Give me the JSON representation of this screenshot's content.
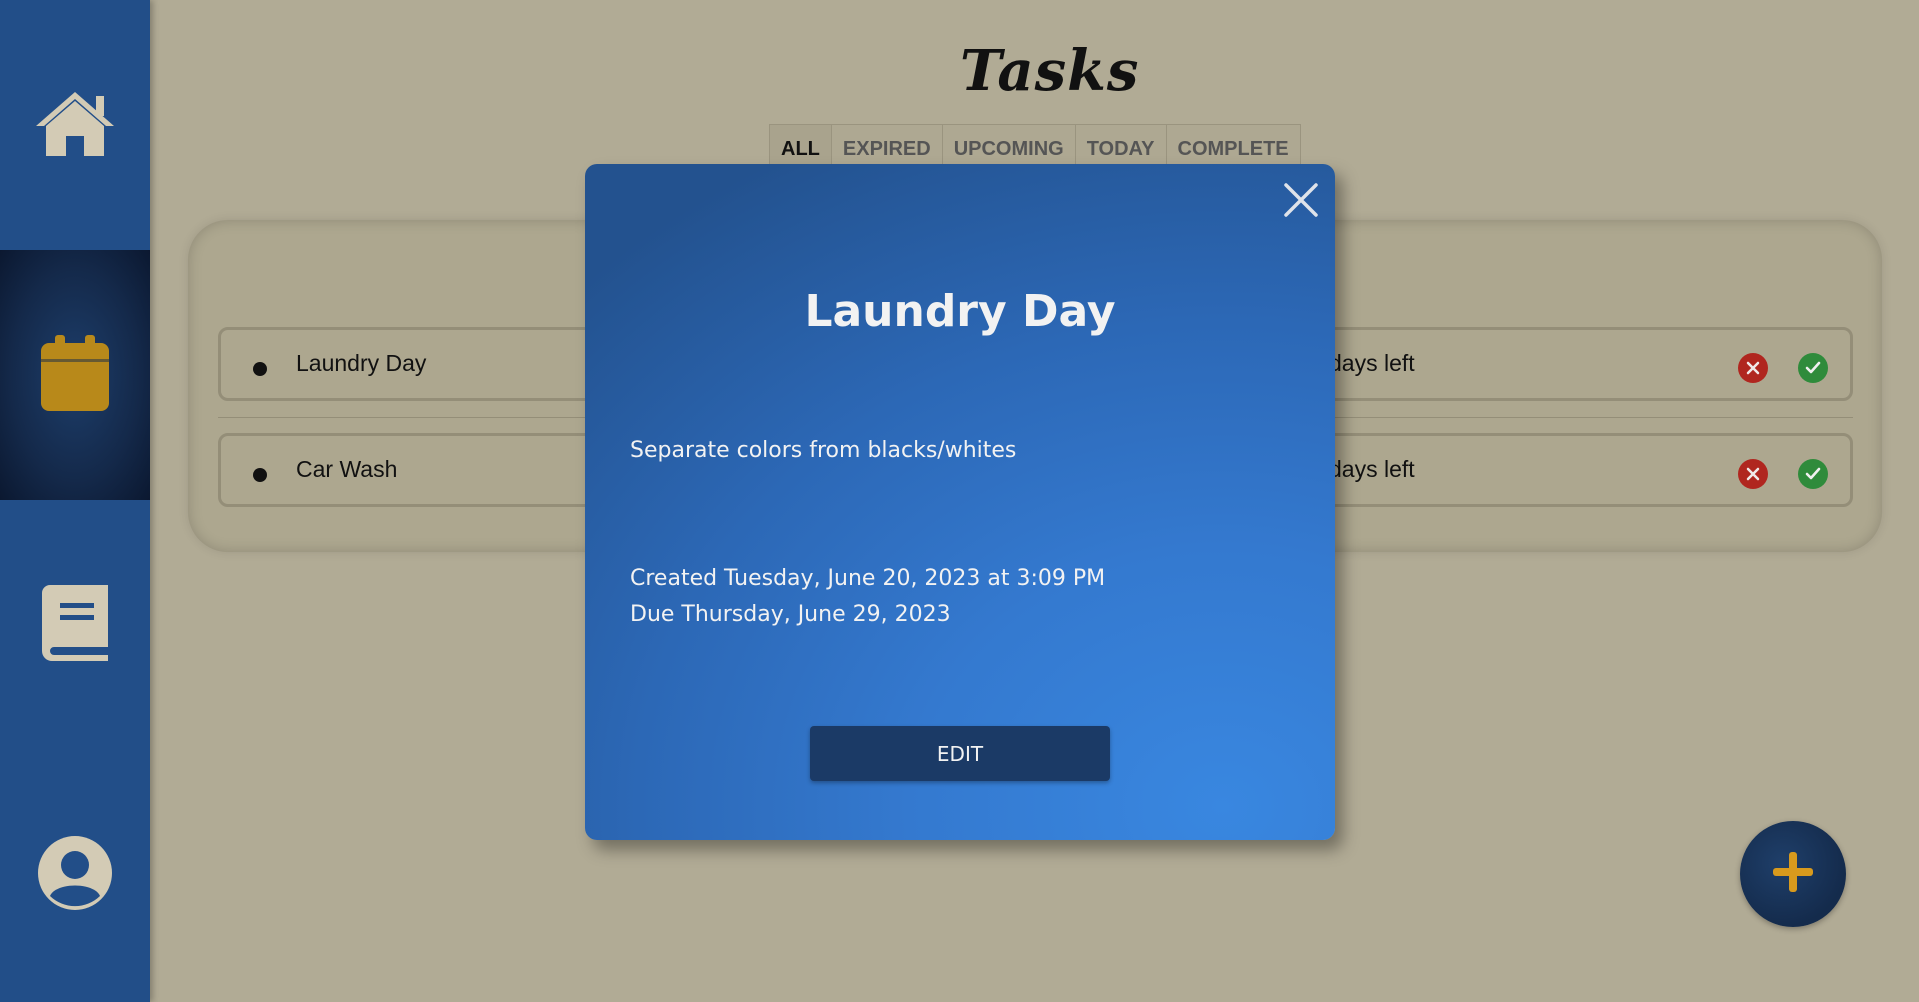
{
  "colors": {
    "sidebar": "#224e88",
    "background": "#b1ab95",
    "calendar_accent": "#b8891a",
    "icon_default": "#d3cbb5",
    "modal_blue": "#3479cf",
    "edit_button": "#1b3a66",
    "delete": "#b0261f",
    "complete": "#2f8b3b",
    "fab_plus": "#d89a1d"
  },
  "sidebar": {
    "items": [
      {
        "icon": "home-icon",
        "active": false
      },
      {
        "icon": "calendar-icon",
        "active": true
      },
      {
        "icon": "book-icon",
        "active": false
      },
      {
        "icon": "user-icon",
        "active": false
      }
    ]
  },
  "header": {
    "title": "Tasks"
  },
  "tabs": [
    {
      "label": "ALL",
      "active": true
    },
    {
      "label": "EXPIRED",
      "active": false
    },
    {
      "label": "UPCOMING",
      "active": false
    },
    {
      "label": "TODAY",
      "active": false
    },
    {
      "label": "COMPLETE",
      "active": false
    }
  ],
  "tasks": [
    {
      "name": "Laundry Day",
      "days_left": "days left",
      "delete_icon": "close-circle-icon",
      "complete_icon": "check-circle-icon"
    },
    {
      "name": "Car Wash",
      "days_left": "days left",
      "delete_icon": "close-circle-icon",
      "complete_icon": "check-circle-icon"
    }
  ],
  "fab": {
    "icon": "plus-icon"
  },
  "modal": {
    "title": "Laundry Day",
    "description": "Separate colors from blacks/whites",
    "created": "Created Tuesday, June 20, 2023 at 3:09 PM",
    "due": "Due Thursday, June 29, 2023",
    "edit_label": "EDIT",
    "close_icon": "close-icon"
  }
}
